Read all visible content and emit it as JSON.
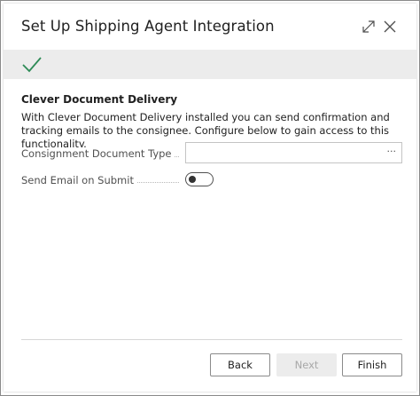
{
  "dialog": {
    "title": "Set Up Shipping Agent Integration"
  },
  "status": {
    "icon": "checkmark-icon",
    "color": "#2e8b57"
  },
  "section": {
    "title": "Clever Document Delivery",
    "description": "With Clever Document Delivery installed you can send confirmation and tracking emails to the consignee. Configure below to gain access to this functionality."
  },
  "fields": {
    "consignment_document_type": {
      "label": "Consignment Document Type",
      "value": "",
      "lookup_label": "···"
    },
    "send_email_on_submit": {
      "label": "Send Email on Submit",
      "value": false
    }
  },
  "footer": {
    "back_label": "Back",
    "next_label": "Next",
    "finish_label": "Finish"
  }
}
